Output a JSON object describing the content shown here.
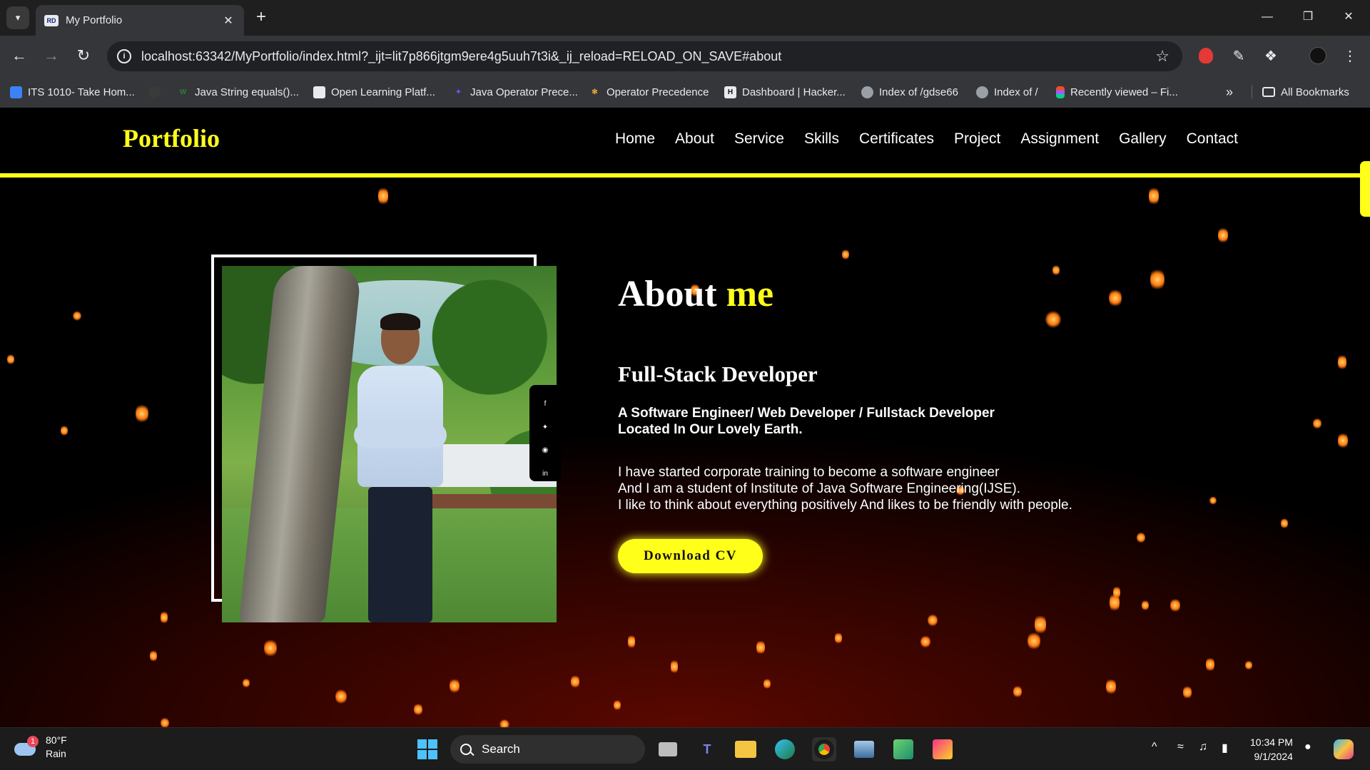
{
  "browser": {
    "tab_title": "My Portfolio",
    "tab_favicon": "RD",
    "url": "localhost:63342/MyPortfolio/index.html?_ijt=lit7p866jtgm9ere4g5uuh7t3i&_ij_reload=RELOAD_ON_SAVE#about",
    "bookmarks": [
      {
        "label": "ITS 1010- Take Hom...",
        "icon": "person-badge-icon",
        "color": "#3b82f6"
      },
      {
        "label": "",
        "icon": "github-icon",
        "color": "#3a3a3a"
      },
      {
        "label": "Java String equals()...",
        "icon": "w-logo-icon",
        "color": "#2e7d32"
      },
      {
        "label": "Open Learning Platf...",
        "icon": "open-learning-icon",
        "color": "#e8eaed"
      },
      {
        "label": "Java Operator Prece...",
        "icon": "feather-icon",
        "color": "#7c4dff"
      },
      {
        "label": "Operator Precedence",
        "icon": "bee-icon",
        "color": "#f2a93b"
      },
      {
        "label": "Dashboard | Hacker...",
        "icon": "hackerrank-icon",
        "color": "#e8eaed"
      },
      {
        "label": "Index of /gdse66",
        "icon": "globe-icon",
        "color": "#9aa0a6"
      },
      {
        "label": "Index of /",
        "icon": "globe-icon",
        "color": "#9aa0a6"
      },
      {
        "label": "Recently viewed – Fi...",
        "icon": "figma-icon",
        "color": "#f24e1e"
      }
    ],
    "all_bookmarks": "All Bookmarks"
  },
  "site": {
    "brand": "Portfolio",
    "nav": [
      "Home",
      "About",
      "Service",
      "Skills",
      "Certificates",
      "Project",
      "Assignment",
      "Gallery",
      "Contact"
    ],
    "accent": "#ffff1a"
  },
  "about": {
    "title_main": "About",
    "title_highlight": "me",
    "role": "Full-Stack Developer",
    "tagline_1": "A Software Engineer/ Web Developer / Fullstack Developer",
    "tagline_2": "Located In Our Lovely Earth.",
    "bio_1": "I have started corporate training to become a software engineer",
    "bio_2": "And I am a student of Institute of Java Software Engineering(IJSE).",
    "bio_3": "I like to think about everything positively And likes to be friendly with people.",
    "cta": "Download CV",
    "social": [
      "facebook-icon",
      "twitter-icon",
      "github-icon",
      "linkedin-icon"
    ]
  },
  "taskbar": {
    "weather_temp": "80°F",
    "weather_desc": "Rain",
    "weather_badge": "1",
    "search_label": "Search",
    "time": "10:34 PM",
    "date": "9/1/2024"
  }
}
